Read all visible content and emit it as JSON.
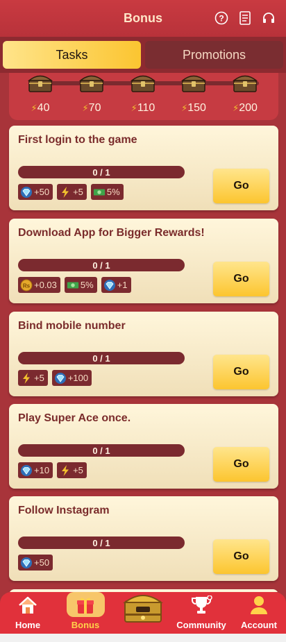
{
  "header": {
    "title": "Bonus",
    "icons": [
      "help-icon",
      "document-icon",
      "headset-icon"
    ]
  },
  "tabs": [
    {
      "label": "Tasks",
      "active": true
    },
    {
      "label": "Promotions",
      "active": false
    }
  ],
  "chests": [
    {
      "value": "40"
    },
    {
      "value": "70"
    },
    {
      "value": "110"
    },
    {
      "value": "150"
    },
    {
      "value": "200"
    }
  ],
  "tasks": [
    {
      "title": "First login to the game",
      "progress": "0 / 1",
      "go": "Go",
      "rewards": [
        {
          "icon": "diamond-icon",
          "text": "+50"
        },
        {
          "icon": "bolt-icon",
          "text": "+5"
        },
        {
          "icon": "cash-icon",
          "text": "5%"
        }
      ]
    },
    {
      "title": "Download App for Bigger Rewards!",
      "progress": "0 / 1",
      "go": "Go",
      "rewards": [
        {
          "icon": "coin-icon",
          "text": "+0.03"
        },
        {
          "icon": "cash-icon",
          "text": "5%"
        },
        {
          "icon": "diamond-icon",
          "text": "+1"
        }
      ]
    },
    {
      "title": "Bind mobile number",
      "progress": "0 / 1",
      "go": "Go",
      "rewards": [
        {
          "icon": "bolt-icon",
          "text": "+5"
        },
        {
          "icon": "diamond-icon",
          "text": "+100"
        }
      ]
    },
    {
      "title": "Play Super Ace once.",
      "progress": "0 / 1",
      "go": "Go",
      "rewards": [
        {
          "icon": "diamond-icon",
          "text": "+10"
        },
        {
          "icon": "bolt-icon",
          "text": "+5"
        }
      ]
    },
    {
      "title": "Follow Instagram",
      "progress": "0 / 1",
      "go": "Go",
      "rewards": [
        {
          "icon": "diamond-icon",
          "text": "+50"
        }
      ]
    }
  ],
  "nav": {
    "home": "Home",
    "bonus": "Bonus",
    "community": "Community",
    "account": "Account"
  },
  "colors": {
    "primary": "#c93a41",
    "accent": "#fcc52f",
    "card": "#fff6db",
    "dark": "#7b2a2f"
  }
}
